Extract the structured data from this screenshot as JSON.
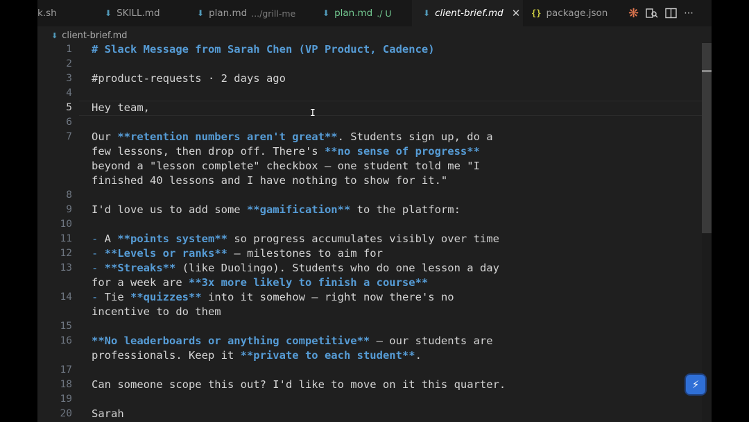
{
  "tabs": [
    {
      "name": "k.sh",
      "icon": "terminal-icon"
    },
    {
      "name": "SKILL.md",
      "icon": "markdown-icon"
    },
    {
      "name": "plan.md",
      "desc": ".../grill-me",
      "icon": "markdown-icon"
    },
    {
      "name": "plan.md",
      "desc": "./ U",
      "icon": "markdown-icon"
    },
    {
      "name": "client-brief.md",
      "close": "✕",
      "icon": "markdown-icon"
    },
    {
      "name": "package.json",
      "icon": "json-icon",
      "glyph": "{}"
    }
  ],
  "breadcrumb": {
    "file": "client-brief.md"
  },
  "editor": {
    "line_numbers": [
      "1",
      "2",
      "3",
      "4",
      "5",
      "6",
      "7",
      "8",
      "9",
      "10",
      "11",
      "12",
      "13",
      "14",
      "15",
      "16",
      "17",
      "18",
      "19",
      "20"
    ],
    "l1": "# Slack Message from Sarah Chen (VP Product, Cadence)",
    "l3": "#product-requests · 2 days ago",
    "l5": "Hey team,",
    "l7a_1": "Our ",
    "l7a_2": "**retention numbers aren't great**",
    "l7a_3": ". Students sign up, do a",
    "l7b_1": "few lessons, then drop off. There's ",
    "l7b_2": "**no sense of progress**",
    "l7c": "beyond a \"lesson complete\" checkbox — one student told me \"I",
    "l7d": "finished 40 lessons and I have nothing to show for it.\"",
    "l9_1": "I'd love us to add some ",
    "l9_2": "**gamification**",
    "l9_3": " to the platform:",
    "l11_1": "-",
    "l11_2": " A ",
    "l11_3": "**points system**",
    "l11_4": " so progress accumulates visibly over time",
    "l12_1": "-",
    "l12_2": " ",
    "l12_3": "**Levels or ranks**",
    "l12_4": " — milestones to aim for",
    "l13a_1": "-",
    "l13a_2": " ",
    "l13a_3": "**Streaks**",
    "l13a_4": " (like Duolingo). Students who do one lesson a day",
    "l13b_1": "for a week are ",
    "l13b_2": "**3x more likely to finish a course**",
    "l14a_1": "-",
    "l14a_2": " Tie ",
    "l14a_3": "**quizzes**",
    "l14a_4": " into it somehow — right now there's no",
    "l14b": "incentive to do them",
    "l16a_1": "**No leaderboards or anything competitive**",
    "l16a_2": " — our students are",
    "l16b_1": "professionals. Keep it ",
    "l16b_2": "**private to each student**",
    "l16b_3": ".",
    "l18": "Can someone scope this out? I'd like to move on it this quarter.",
    "l20": "Sarah"
  },
  "colors": {
    "keyword": "#569cd6",
    "text": "#d4d4d4",
    "background": "#1f1f1f",
    "modified": "#73c991"
  }
}
